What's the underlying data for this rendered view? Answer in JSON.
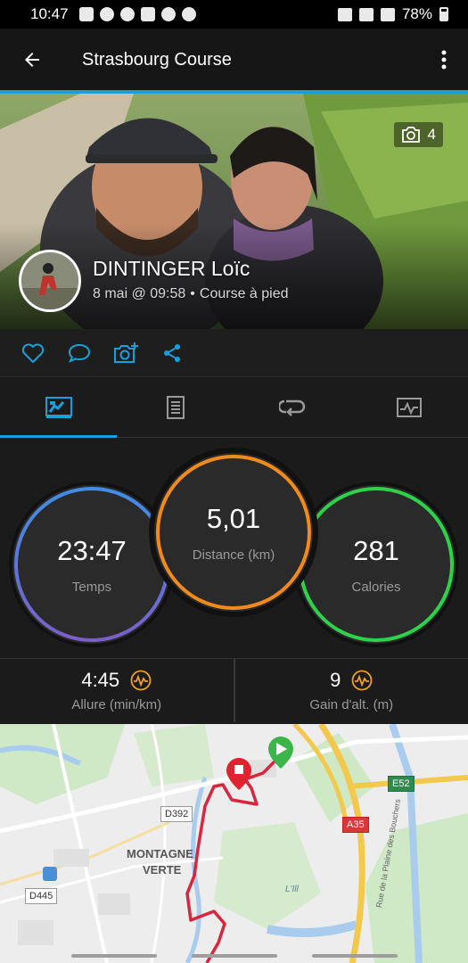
{
  "status_bar": {
    "time": "10:47",
    "battery": "78%"
  },
  "header": {
    "title": "Strasbourg Course"
  },
  "hero": {
    "photo_count": "4",
    "athlete_name": "DINTINGER Loïc",
    "date": "8 mai @ 09:58",
    "activity_type": "Course à pied"
  },
  "colors": {
    "accent": "#1aa0d8",
    "time_ring": "#7a5fc9",
    "distance_ring": "#f08a1c",
    "calories_ring": "#2ed14a"
  },
  "stats": {
    "time": {
      "value": "23:47",
      "label": "Temps"
    },
    "distance": {
      "value": "5,01",
      "label": "Distance (km)"
    },
    "calories": {
      "value": "281",
      "label": "Calories"
    }
  },
  "substats": [
    {
      "value": "4:45",
      "label": "Allure (min/km)"
    },
    {
      "value": "9",
      "label": "Gain d'alt. (m)"
    }
  ],
  "map": {
    "labels": {
      "district_line1": "MONTAGNE",
      "district_line2": "VERTE",
      "river": "L'Ill",
      "street": "Rue de la Plaine des Bouchers"
    },
    "shields": {
      "d392": "D392",
      "d445": "D445",
      "a35": "A35",
      "e52": "E52"
    }
  }
}
